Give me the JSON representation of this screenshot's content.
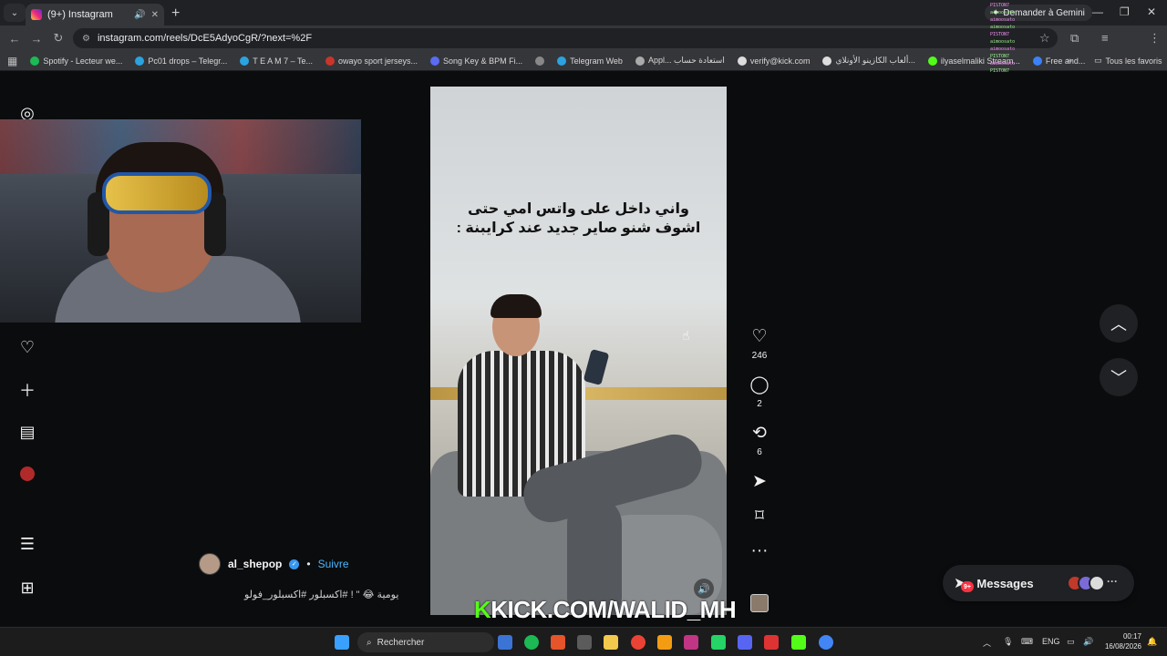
{
  "browser": {
    "tab_title": "(9+) Instagram",
    "new_tab": "+",
    "gemini_label": "Demander à Gemini",
    "url": "instagram.com/reels/DcE5AdyoCgR/?next=%2F",
    "window_controls": [
      "—",
      "❐",
      "✕"
    ]
  },
  "bookmarks": [
    {
      "label": "Spotify - Lecteur we...",
      "color": "#1db954"
    },
    {
      "label": "Pc01 drops – Telegr...",
      "color": "#2aa3e0"
    },
    {
      "label": "T E A M 7 – Te...",
      "color": "#2aa3e0"
    },
    {
      "label": "owayo sport jerseys...",
      "color": "#c9352b"
    },
    {
      "label": "Song Key & BPM Fi...",
      "color": "#5a6cf2"
    },
    {
      "label": "",
      "color": "#888888"
    },
    {
      "label": "Telegram Web",
      "color": "#2aa3e0"
    },
    {
      "label": "Appl... استعادة حساب",
      "color": "#aaaaaa"
    },
    {
      "label": "verify@kick.com",
      "color": "#dddddd"
    },
    {
      "label": "ألعاب الكازينو الأونلاي...",
      "color": "#dddddd"
    },
    {
      "label": "ilyaselmaliki Stream...",
      "color": "#53fc18"
    },
    {
      "label": "Free and...",
      "color": "#3b82f6"
    }
  ],
  "bookmarks_all": "Tous les favoris",
  "chat_overlay": [
    "PISTON7",
    "aimoosato",
    "aimoosato",
    "aimoosato",
    "PISTON7",
    "aimoosato",
    "aimoosato",
    "PISTON7",
    "aimoosato",
    "PISTON7"
  ],
  "reel": {
    "overlay_line1": "واني داخل على واتس امي حتى",
    "overlay_line2": "اشوف شنو صاير جديد عند كرايبنة :",
    "author": "al_shepop",
    "follow": "Suivre",
    "separator": "•",
    "description": "يومية 😂 \" ! #اكسبلور #اكسبلور_فولو",
    "likes": "246",
    "comments": "2",
    "reposts": "6"
  },
  "watermark": {
    "k": "K",
    "text": "KICK.COM/WALID_MH"
  },
  "messages": {
    "label": "Messages",
    "badge": "9+"
  },
  "taskbar": {
    "search_placeholder": "Rechercher",
    "language": "ENG",
    "time": "00:17",
    "date": "16/08/2026"
  },
  "colors": {
    "instagram_blue": "#4cb5f9",
    "kick_green": "#53fc18",
    "notification_red": "#ff3040"
  }
}
